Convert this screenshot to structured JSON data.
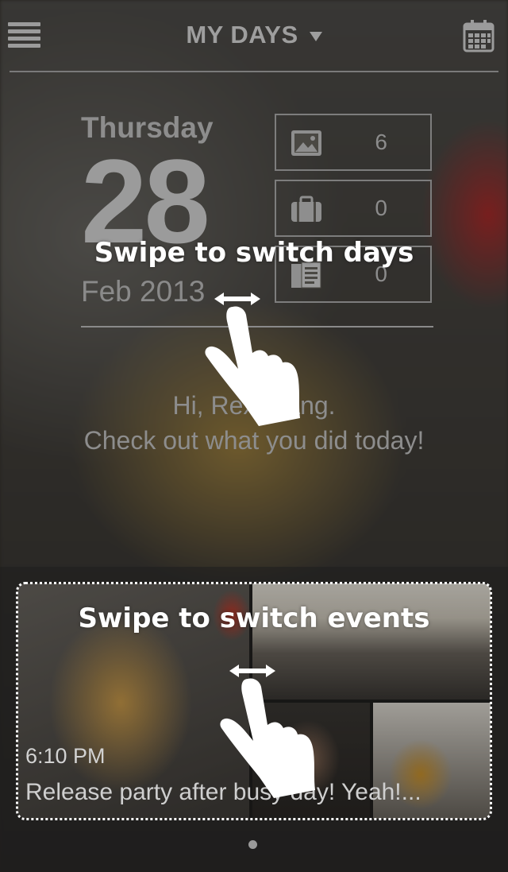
{
  "header": {
    "title": "MY DAYS",
    "icons": {
      "menu": "menu-icon",
      "caret": "caret-down-icon",
      "calendar": "calendar-icon"
    }
  },
  "date": {
    "weekday": "Thursday",
    "day": "28",
    "month": "Feb",
    "year": "2013"
  },
  "stats": [
    {
      "icon": "photo-icon",
      "count": "6"
    },
    {
      "icon": "briefcase-icon",
      "count": "0"
    },
    {
      "icon": "notes-icon",
      "count": "0"
    }
  ],
  "greeting": {
    "line1": "Hi, Rex Wang.",
    "line2": "Check out what you did today!"
  },
  "event": {
    "time": "6:10 PM",
    "caption": "Release party after busy day! Yeah!..."
  },
  "hints": {
    "days": "Swipe to switch days",
    "events": "Swipe to switch events"
  },
  "colors": {
    "overlay_text": "#ffffff",
    "muted_text": "#8d8d8d"
  }
}
